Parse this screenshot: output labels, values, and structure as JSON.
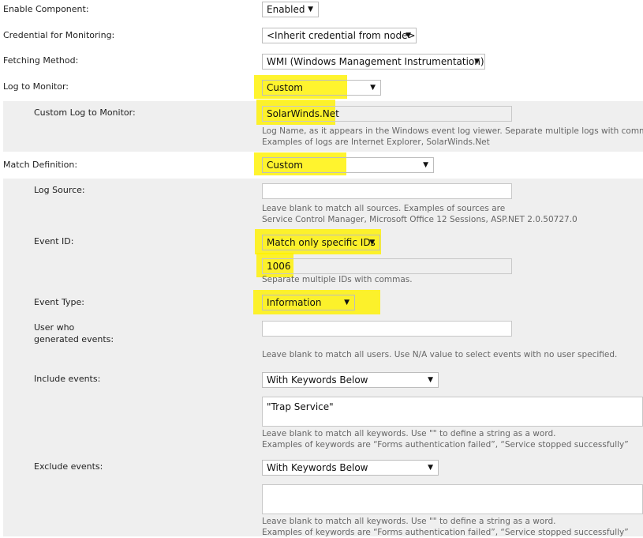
{
  "form": {
    "enable_component": {
      "label": "Enable Component:",
      "value": "Enabled"
    },
    "credential": {
      "label": "Credential for Monitoring:",
      "value": "<Inherit credential from node>"
    },
    "fetching_method": {
      "label": "Fetching Method:",
      "value": "WMI (Windows Management Instrumentation)"
    },
    "log_to_monitor": {
      "label": "Log to Monitor:",
      "value": "Custom"
    },
    "custom_log": {
      "label": "Custom Log to Monitor:",
      "value": "SolarWinds.Net",
      "help1": "Log Name, as it appears in the Windows event log viewer. Separate multiple logs with commas.",
      "help2": "Examples of logs are Internet Explorer, SolarWinds.Net"
    },
    "match_definition": {
      "label": "Match Definition:",
      "value": "Custom"
    },
    "log_source": {
      "label": "Log Source:",
      "value": "",
      "help1": "Leave blank to match all sources. Examples of sources are",
      "help2": "Service Control Manager, Microsoft Office 12 Sessions, ASP.NET 2.0.50727.0"
    },
    "event_id": {
      "label": "Event ID:",
      "mode": "Match only specific IDs",
      "value": "1006",
      "help": "Separate multiple IDs with commas."
    },
    "event_type": {
      "label": "Event Type:",
      "value": "Information"
    },
    "user": {
      "label1": "User who",
      "label2": "generated events:",
      "value": "",
      "help": "Leave blank to match all users. Use N/A value to select events with no user specified."
    },
    "include_events": {
      "label": "Include events:",
      "mode": "With Keywords Below",
      "value": "\"Trap Service\"",
      "help1": "Leave blank to match all keywords. Use \"\" to define a string as a word.",
      "help2": "Examples of keywords are “Forms authentication failed”, “Service stopped successfully”"
    },
    "exclude_events": {
      "label": "Exclude events:",
      "mode": "With Keywords Below",
      "value": "",
      "help1": "Leave blank to match all keywords. Use \"\" to define a string as a word.",
      "help2": "Examples of keywords are “Forms authentication failed”, “Service stopped successfully”"
    }
  },
  "icons": {
    "dropdown": "down-triangle-icon"
  },
  "colors": {
    "highlight": "#fff200",
    "band": "#efefef",
    "help_text": "#666666"
  }
}
